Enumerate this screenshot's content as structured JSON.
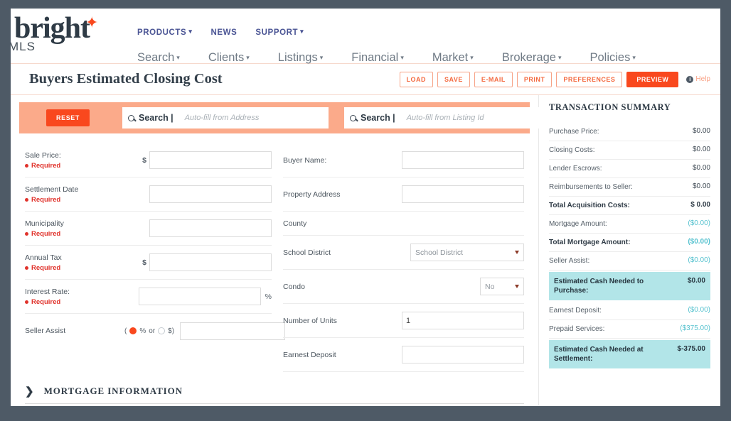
{
  "brand": {
    "word": "bright",
    "star": "✦",
    "sub": "MLS"
  },
  "util_nav": [
    {
      "label": "PRODUCTS",
      "caret": "▾"
    },
    {
      "label": "NEWS",
      "caret": ""
    },
    {
      "label": "SUPPORT",
      "caret": "▾"
    }
  ],
  "main_nav": [
    {
      "label": "Search",
      "caret": "▾"
    },
    {
      "label": "Clients",
      "caret": "▾"
    },
    {
      "label": "Listings",
      "caret": "▾"
    },
    {
      "label": "Financial",
      "caret": "▾"
    },
    {
      "label": "Market",
      "caret": "▾"
    },
    {
      "label": "Brokerage",
      "caret": "▾"
    },
    {
      "label": "Policies",
      "caret": "▾"
    }
  ],
  "header": {
    "title": "Buyers Estimated Closing Cost",
    "buttons": [
      {
        "label": "LOAD"
      },
      {
        "label": "SAVE"
      },
      {
        "label": "E-MAIL"
      },
      {
        "label": "PRINT"
      },
      {
        "label": "PREFERENCES"
      }
    ],
    "preview_label": "PREVIEW",
    "help_label": "Help",
    "help_glyph": "i"
  },
  "searchbar": {
    "reset_label": "RESET",
    "search_label_1": "Search |",
    "placeholder_1": "Auto-fill from Address",
    "search_label_2": "Search |",
    "placeholder_2": "Auto-fill from Listing Id"
  },
  "form": {
    "required_text": "Required",
    "left": [
      {
        "label": "Sale Price:",
        "required": true,
        "prefix": "$",
        "value": "",
        "type": "money"
      },
      {
        "label": "Settlement Date",
        "required": true,
        "prefix": "",
        "value": "",
        "type": "text"
      },
      {
        "label": "Municipality",
        "required": true,
        "prefix": "",
        "value": "",
        "type": "text"
      },
      {
        "label": "Annual Tax",
        "required": true,
        "prefix": "$",
        "value": "",
        "type": "money"
      },
      {
        "label": "Interest Rate:",
        "required": true,
        "suffix": "%",
        "value": "",
        "type": "percent"
      },
      {
        "label": "Seller Assist",
        "required": false,
        "value": "",
        "type": "radio-money"
      }
    ],
    "seller_assist": {
      "open_paren": "(",
      "pct_symbol": "%",
      "or_text": "or",
      "dollar_symbol": "$)",
      "selected": "percent"
    },
    "right": [
      {
        "label": "Buyer Name:",
        "value": "",
        "type": "text"
      },
      {
        "label": "Property Address",
        "value": "",
        "type": "text"
      },
      {
        "label": "County",
        "value": "",
        "type": "none"
      },
      {
        "label": "School District",
        "value": "School District",
        "type": "select"
      },
      {
        "label": "Condo",
        "value": "No",
        "type": "select-narrow"
      },
      {
        "label": "Number of Units",
        "value": "1",
        "type": "text"
      },
      {
        "label": "Earnest Deposit",
        "value": "",
        "type": "text"
      }
    ]
  },
  "mortgage_section": {
    "chevron": "❯",
    "title": "MORTGAGE INFORMATION"
  },
  "summary": {
    "title": "TRANSACTION SUMMARY",
    "rows": [
      {
        "label": "Purchase Price:",
        "value": "$0.00",
        "style": "plain"
      },
      {
        "label": "Closing Costs:",
        "value": "$0.00",
        "style": "plain"
      },
      {
        "label": "Lender Escrows:",
        "value": "$0.00",
        "style": "plain"
      },
      {
        "label": "Reimbursements to Seller:",
        "value": "$0.00",
        "style": "plain"
      },
      {
        "label": "Total Acquisition Costs:",
        "value": "$ 0.00",
        "style": "bold"
      },
      {
        "label": "Mortgage Amount:",
        "value": "($0.00)",
        "style": "teal"
      },
      {
        "label": "Total Mortgage Amount:",
        "value": "($0.00)",
        "style": "bold teal"
      },
      {
        "label": "Seller Assist:",
        "value": "($0.00)",
        "style": "teal"
      },
      {
        "label": "Estimated Cash Needed to Purchase:",
        "value": "$0.00",
        "style": "hl"
      },
      {
        "label": "Earnest Deposit:",
        "value": "($0.00)",
        "style": "teal"
      },
      {
        "label": "Prepaid Services:",
        "value": "($375.00)",
        "style": "teal"
      },
      {
        "label": "Estimated Cash Needed at Settlement:",
        "value": "$-375.00",
        "style": "hl"
      }
    ]
  },
  "colors": {
    "accent": "#f9481e",
    "accent_light": "#fbaa8a",
    "nav_blue": "#4a5494",
    "teal": "#56c2cf",
    "teal_bg": "#b2e5e8",
    "required_red": "#e0322b",
    "frame": "#4e5a66"
  }
}
